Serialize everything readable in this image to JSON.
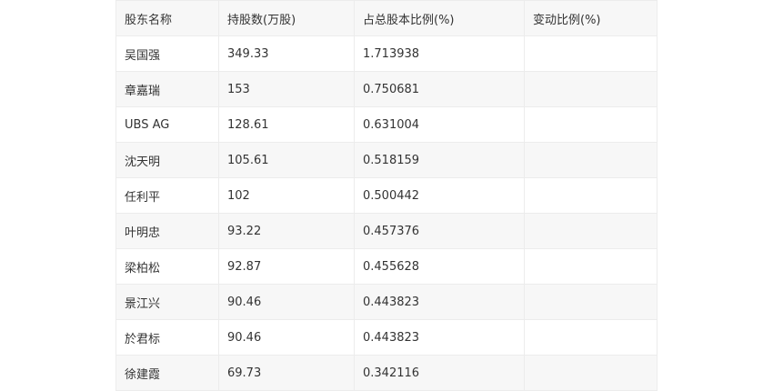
{
  "table": {
    "headers": [
      "股东名称",
      "持股数(万股)",
      "占总股本比例(%)",
      "变动比例(%)"
    ],
    "rows": [
      [
        "吴国强",
        "349.33",
        "1.713938",
        ""
      ],
      [
        "章嘉瑞",
        "153",
        "0.750681",
        ""
      ],
      [
        "UBS AG",
        "128.61",
        "0.631004",
        ""
      ],
      [
        "沈天明",
        "105.61",
        "0.518159",
        ""
      ],
      [
        "任利平",
        "102",
        "0.500442",
        ""
      ],
      [
        "叶明忠",
        "93.22",
        "0.457376",
        ""
      ],
      [
        "梁柏松",
        "92.87",
        "0.455628",
        ""
      ],
      [
        "景江兴",
        "90.46",
        "0.443823",
        ""
      ],
      [
        "於君标",
        "90.46",
        "0.443823",
        ""
      ],
      [
        "徐建霞",
        "69.73",
        "0.342116",
        ""
      ]
    ]
  }
}
